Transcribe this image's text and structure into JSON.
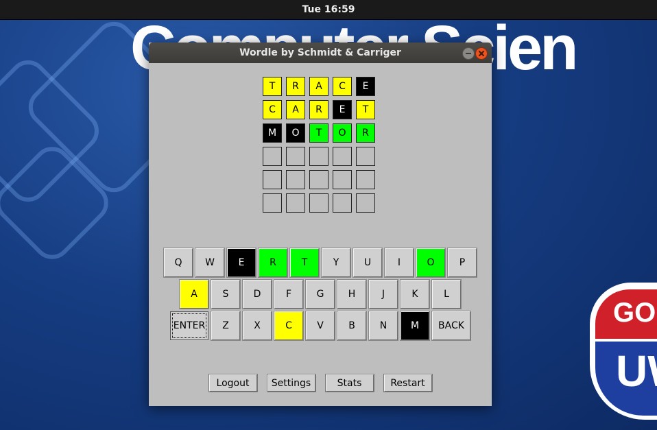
{
  "system": {
    "clock": "Tue 16:59"
  },
  "wallpaper": {
    "title": "Computer Scien",
    "logo_top": "GO",
    "logo_bottom": "UW"
  },
  "window": {
    "title": "Wordle by Schmidt & Carriger"
  },
  "colors": {
    "correct": "#00ff00",
    "present": "#ffff00",
    "absent": "#000000",
    "panel": "#bebebe"
  },
  "board": {
    "rows": [
      [
        {
          "l": "T",
          "s": "yellow"
        },
        {
          "l": "R",
          "s": "yellow"
        },
        {
          "l": "A",
          "s": "yellow"
        },
        {
          "l": "C",
          "s": "yellow"
        },
        {
          "l": "E",
          "s": "black"
        }
      ],
      [
        {
          "l": "C",
          "s": "yellow"
        },
        {
          "l": "A",
          "s": "yellow"
        },
        {
          "l": "R",
          "s": "yellow"
        },
        {
          "l": "E",
          "s": "black"
        },
        {
          "l": "T",
          "s": "yellow"
        }
      ],
      [
        {
          "l": "M",
          "s": "black"
        },
        {
          "l": "O",
          "s": "black"
        },
        {
          "l": "T",
          "s": "green"
        },
        {
          "l": "O",
          "s": "green"
        },
        {
          "l": "R",
          "s": "green"
        }
      ],
      [
        {
          "l": "",
          "s": "empty"
        },
        {
          "l": "",
          "s": "empty"
        },
        {
          "l": "",
          "s": "empty"
        },
        {
          "l": "",
          "s": "empty"
        },
        {
          "l": "",
          "s": "empty"
        }
      ],
      [
        {
          "l": "",
          "s": "empty"
        },
        {
          "l": "",
          "s": "empty"
        },
        {
          "l": "",
          "s": "empty"
        },
        {
          "l": "",
          "s": "empty"
        },
        {
          "l": "",
          "s": "empty"
        }
      ],
      [
        {
          "l": "",
          "s": "empty"
        },
        {
          "l": "",
          "s": "empty"
        },
        {
          "l": "",
          "s": "empty"
        },
        {
          "l": "",
          "s": "empty"
        },
        {
          "l": "",
          "s": "empty"
        }
      ]
    ]
  },
  "keyboard": {
    "rows": [
      [
        {
          "k": "Q",
          "s": ""
        },
        {
          "k": "W",
          "s": ""
        },
        {
          "k": "E",
          "s": "black"
        },
        {
          "k": "R",
          "s": "green"
        },
        {
          "k": "T",
          "s": "green"
        },
        {
          "k": "Y",
          "s": ""
        },
        {
          "k": "U",
          "s": ""
        },
        {
          "k": "I",
          "s": ""
        },
        {
          "k": "O",
          "s": "green"
        },
        {
          "k": "P",
          "s": ""
        }
      ],
      [
        {
          "k": "A",
          "s": "yellow"
        },
        {
          "k": "S",
          "s": ""
        },
        {
          "k": "D",
          "s": ""
        },
        {
          "k": "F",
          "s": ""
        },
        {
          "k": "G",
          "s": ""
        },
        {
          "k": "H",
          "s": ""
        },
        {
          "k": "J",
          "s": ""
        },
        {
          "k": "K",
          "s": ""
        },
        {
          "k": "L",
          "s": ""
        }
      ],
      [
        {
          "k": "ENTER",
          "s": "",
          "wide": true
        },
        {
          "k": "Z",
          "s": ""
        },
        {
          "k": "X",
          "s": ""
        },
        {
          "k": "C",
          "s": "yellow"
        },
        {
          "k": "V",
          "s": ""
        },
        {
          "k": "B",
          "s": ""
        },
        {
          "k": "N",
          "s": ""
        },
        {
          "k": "M",
          "s": "black"
        },
        {
          "k": "BACK",
          "s": "",
          "wide": true
        }
      ]
    ]
  },
  "buttons": {
    "logout": "Logout",
    "settings": "Settings",
    "stats": "Stats",
    "restart": "Restart"
  }
}
